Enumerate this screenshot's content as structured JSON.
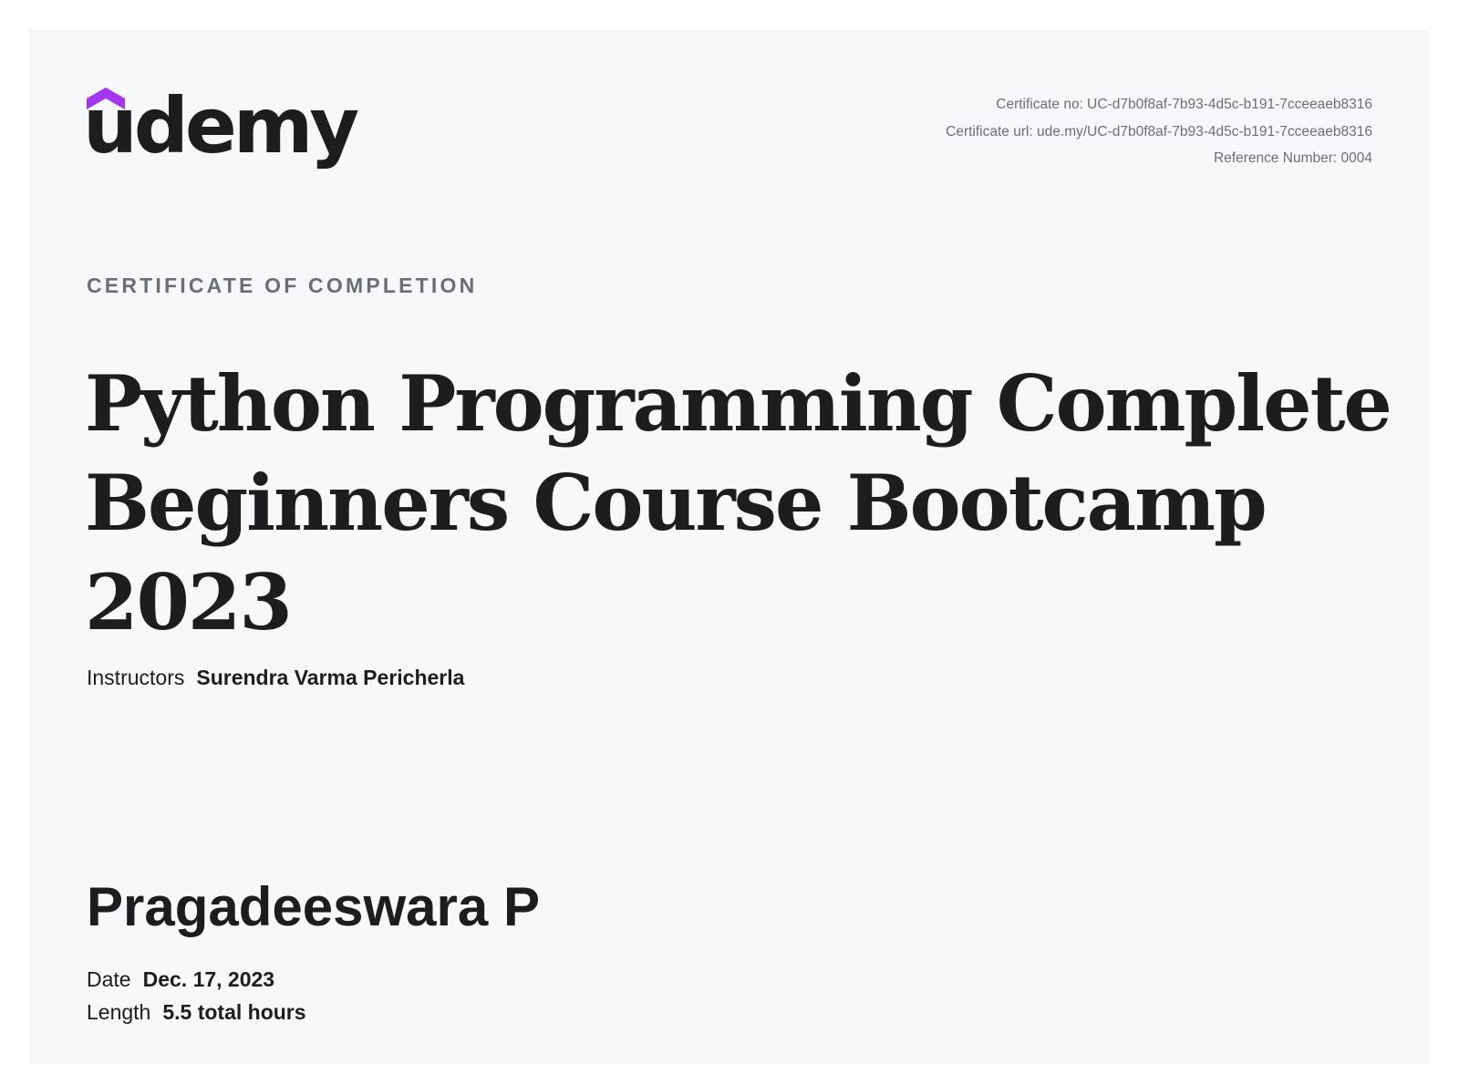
{
  "brand": {
    "logo_text": "udemy",
    "accent_color": "#a435f0",
    "text_color": "#1c1d1f",
    "icon": "udemy-logo-mark"
  },
  "certificate_meta": {
    "certificate_no": "Certificate no: UC-d7b0f8af-7b93-4d5c-b191-7cceeaeb8316",
    "certificate_url": "Certificate url: ude.my/UC-d7b0f8af-7b93-4d5c-b191-7cceeaeb8316",
    "reference_number": "Reference Number: 0004"
  },
  "eyebrow": "CERTIFICATE OF COMPLETION",
  "course_title": "Python Programming Complete Beginners Course Bootcamp 2023",
  "instructors": {
    "label": "Instructors",
    "value": "Surendra Varma Pericherla"
  },
  "recipient_name": "Pragadeeswara P",
  "details": {
    "date_label": "Date",
    "date_value": "Dec. 17, 2023",
    "length_label": "Length",
    "length_value": "5.5 total hours"
  }
}
